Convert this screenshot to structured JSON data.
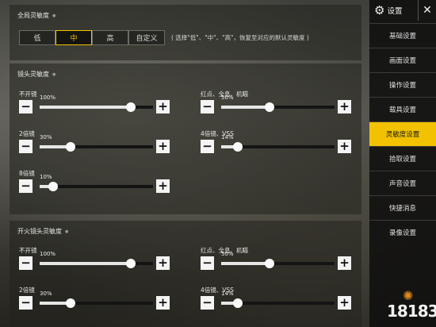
{
  "global": {
    "title": "全局灵敏度",
    "modes": [
      "低",
      "中",
      "高",
      "自定义"
    ],
    "active_mode": "中",
    "hint": "( 选择\"低\"、\"中\"、\"高\"，恢复至对应的默认灵敏度 )"
  },
  "scope": {
    "title": "镜头灵敏度",
    "sliders": [
      {
        "label": "不开镜",
        "value": "100%",
        "fraction": 1.0
      },
      {
        "label": "红点、全息、机瞄",
        "value": "50%",
        "fraction": 0.5
      },
      {
        "label": "2倍镜",
        "value": "30%",
        "fraction": 0.3
      },
      {
        "label": "4倍镜、VSS",
        "value": "14%",
        "fraction": 0.14
      },
      {
        "label": "8倍镜",
        "value": "10%",
        "fraction": 0.1
      }
    ]
  },
  "fire": {
    "title": "开火镜头灵敏度",
    "sliders": [
      {
        "label": "不开镜",
        "value": "100%",
        "fraction": 1.0
      },
      {
        "label": "红点、全息、机瞄",
        "value": "50%",
        "fraction": 0.5
      },
      {
        "label": "2倍镜",
        "value": "30%",
        "fraction": 0.3
      },
      {
        "label": "4倍镜、VSS",
        "value": "14%",
        "fraction": 0.14
      }
    ]
  },
  "sidebar": {
    "title": "设置",
    "close_glyph": "✕",
    "items": [
      "基础设置",
      "画面设置",
      "操作设置",
      "载具设置",
      "灵敏度设置",
      "拾取设置",
      "声音设置",
      "快捷消息",
      "录像设置"
    ],
    "active_index": 4
  },
  "icons": {
    "gear": "⚙",
    "minus": "−",
    "plus": "+"
  },
  "colors": {
    "accent": "#f2c200"
  },
  "watermark": {
    "text": "18183"
  }
}
